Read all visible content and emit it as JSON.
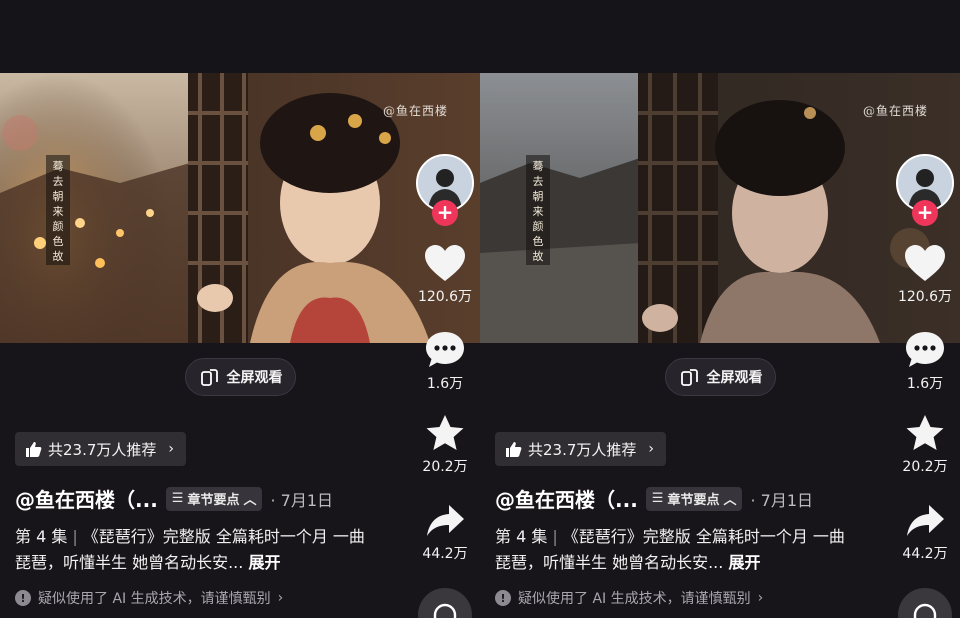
{
  "videos": [
    {
      "watermark": "@鱼在西楼",
      "vertical_text": "蓦去朝来颜色故",
      "fullscreen_label": "全屏观看",
      "recommend_label": "共23.7万人推荐",
      "author": "@鱼在西楼（...",
      "chapter_label": "章节要点",
      "date": "· 7月1日",
      "episode": "第 4 集",
      "description": "《琵琶行》完整版 全篇耗时一个月 一曲琵琶，听懂半生 她曾名动长安...",
      "expand_label": "展开",
      "ai_notice": "疑似使用了 AI 生成技术，请谨慎甄别",
      "likes": "120.6万",
      "comments": "1.6万",
      "favorites": "20.2万",
      "shares": "44.2万",
      "scene": "lanterns"
    },
    {
      "watermark": "@鱼在西楼",
      "vertical_text": "蓦去朝来颜色故",
      "fullscreen_label": "全屏观看",
      "recommend_label": "共23.7万人推荐",
      "author": "@鱼在西楼（...",
      "chapter_label": "章节要点",
      "date": "· 7月1日",
      "episode": "第 4 集",
      "description": "《琵琶行》完整版 全篇耗时一个月 一曲琵琶，听懂半生 她曾名动长安...",
      "expand_label": "展开",
      "ai_notice": "疑似使用了 AI 生成技术，请谨慎甄别",
      "likes": "120.6万",
      "comments": "1.6万",
      "favorites": "20.2万",
      "shares": "44.2万",
      "scene": "rainy"
    }
  ],
  "colors": {
    "background": "#17151a",
    "follow_badge": "#f0355a",
    "pill_background": "#302e33"
  }
}
